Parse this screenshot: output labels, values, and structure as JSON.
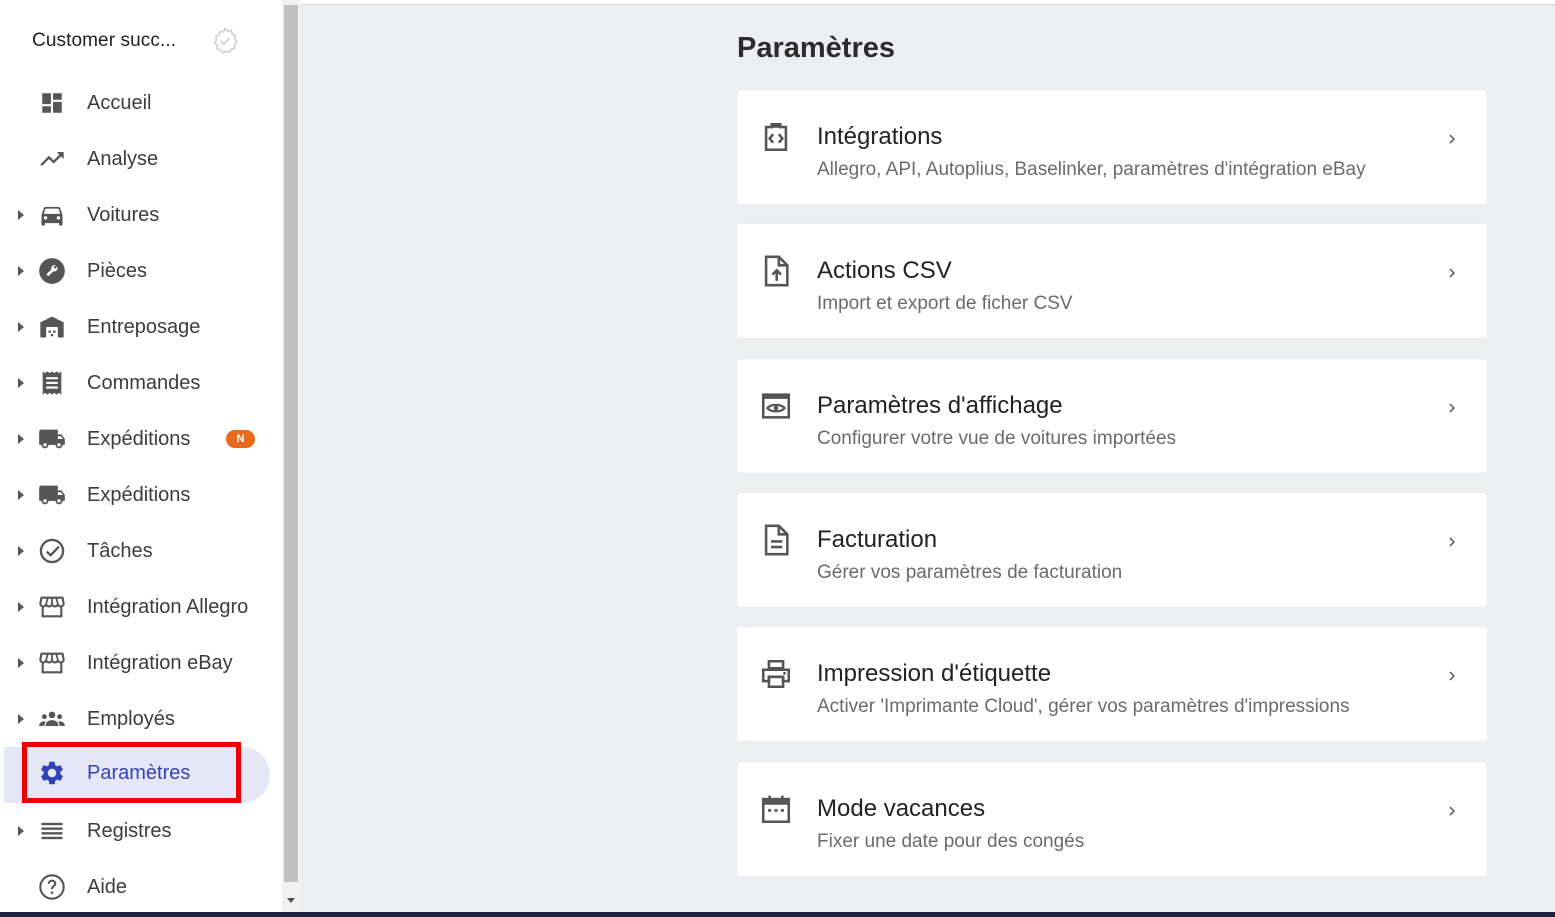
{
  "sidebar": {
    "workspace_title": "Customer succ...",
    "items": [
      {
        "label": "Accueil",
        "icon": "dashboard-icon",
        "expandable": false
      },
      {
        "label": "Analyse",
        "icon": "trending-up-icon",
        "expandable": false
      },
      {
        "label": "Voitures",
        "icon": "car-icon",
        "expandable": true
      },
      {
        "label": "Pièces",
        "icon": "wrench-icon",
        "expandable": true
      },
      {
        "label": "Entreposage",
        "icon": "warehouse-icon",
        "expandable": true
      },
      {
        "label": "Commandes",
        "icon": "receipt-icon",
        "expandable": true
      },
      {
        "label": "Expéditions",
        "icon": "truck-icon",
        "expandable": true,
        "badge": "N"
      },
      {
        "label": "Expéditions",
        "icon": "truck-icon",
        "expandable": true
      },
      {
        "label": "Tâches",
        "icon": "check-circle-icon",
        "expandable": true
      },
      {
        "label": "Intégration Allegro",
        "icon": "storefront-icon",
        "expandable": true
      },
      {
        "label": "Intégration eBay",
        "icon": "storefront-icon",
        "expandable": true
      },
      {
        "label": "Employés",
        "icon": "people-icon",
        "expandable": true
      },
      {
        "label": "Paramètres",
        "icon": "gear-icon",
        "expandable": false,
        "active": true
      },
      {
        "label": "Registres",
        "icon": "list-icon",
        "expandable": true
      },
      {
        "label": "Aide",
        "icon": "help-icon",
        "expandable": false
      }
    ]
  },
  "main": {
    "title": "Paramètres",
    "cards": [
      {
        "title": "Intégrations",
        "subtitle": "Allegro, API, Autoplius, Baselinker, paramètres d'intégration eBay",
        "icon": "integration-code-icon"
      },
      {
        "title": "Actions CSV",
        "subtitle": "Import et export de fi­cher CSV",
        "icon": "file-upload-icon"
      },
      {
        "title": "Paramètres d'affichage",
        "subtitle": "Configurer votre vue de voitures importées",
        "icon": "preview-eye-icon"
      },
      {
        "title": "Facturation",
        "subtitle": "Gérer vos paramètres de facturation",
        "icon": "document-icon"
      },
      {
        "title": "Impression d'étiquette",
        "subtitle": "Activer 'Imprimante Cloud', gérer vos paramètres d'impressions",
        "icon": "printer-icon"
      },
      {
        "title": "Mode vacances",
        "subtitle": "Fixer une date pour des congés",
        "icon": "calendar-icon"
      }
    ]
  },
  "colors": {
    "accent": "#3342b8",
    "active_bg": "#e5e7f7",
    "badge": "#e86a1c",
    "highlight_box": "#ee0000",
    "main_bg": "#eceef1"
  }
}
